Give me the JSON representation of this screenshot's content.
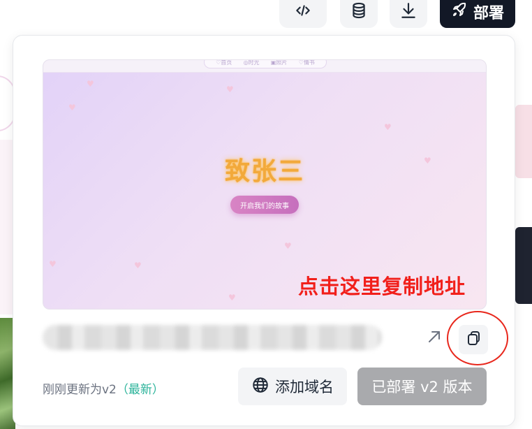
{
  "toolbar": {
    "code_icon": "code-icon",
    "database_icon": "database-icon",
    "download_icon": "download-icon",
    "deploy_icon": "rocket-icon",
    "deploy_label": "部署"
  },
  "preview": {
    "nav_items": [
      "♡首页",
      "◎时光",
      "▣照片",
      "♡情书"
    ],
    "title": "致张三",
    "cta_label": "开启我们的故事"
  },
  "annotation": "点击这里复制地址",
  "url_bar": {
    "open_icon": "external-link-icon",
    "copy_icon": "copy-icon"
  },
  "footer": {
    "status_prefix": "刚刚更新为v2",
    "status_latest": "（最新）",
    "add_domain_icon": "globe-icon",
    "add_domain_label": "添加域名",
    "deployed_label": "已部署 v2 版本"
  },
  "colors": {
    "deploy_bg": "#121826",
    "annotation": "#f1201b",
    "latest": "#2bb39a",
    "deployed_bg": "#a9aaad"
  }
}
